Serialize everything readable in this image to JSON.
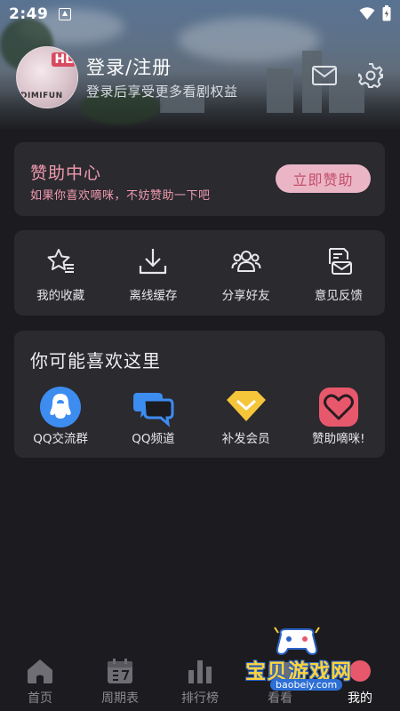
{
  "status": {
    "time": "2:49"
  },
  "header": {
    "avatar_tag": "HL",
    "avatar_sub": "DIMIFUN",
    "login_title": "登录/注册",
    "login_subtitle": "登录后享受更多看剧权益",
    "icons": [
      "mail-icon",
      "settings-icon"
    ]
  },
  "sponsor": {
    "title": "赞助中心",
    "subtitle": "如果你喜欢嘀咪，不妨赞助一下吧",
    "button": "立即赞助",
    "accent": "#f19aae"
  },
  "quick_actions": [
    {
      "label": "我的收藏",
      "icon": "favorites-star-icon"
    },
    {
      "label": "离线缓存",
      "icon": "download-icon"
    },
    {
      "label": "分享好友",
      "icon": "share-friends-icon"
    },
    {
      "label": "意见反馈",
      "icon": "feedback-icon"
    }
  ],
  "recommend": {
    "title": "你可能喜欢这里",
    "items": [
      {
        "label": "QQ交流群",
        "icon": "qq-icon",
        "color": "#3d8cf0"
      },
      {
        "label": "QQ频道",
        "icon": "qq-channel-icon",
        "color": "#3d8cf0"
      },
      {
        "label": "补发会员",
        "icon": "diamond-icon",
        "color": "#f5c53a"
      },
      {
        "label": "赞助嘀咪!",
        "icon": "heart-icon",
        "color": "#e8586c"
      }
    ]
  },
  "bottom_nav": [
    {
      "label": "首页",
      "icon": "home-icon",
      "active": false
    },
    {
      "label": "周期表",
      "icon": "calendar-icon",
      "active": false
    },
    {
      "label": "排行榜",
      "icon": "ranking-icon",
      "active": false
    },
    {
      "label": "看看",
      "icon": "watch-icon",
      "active": false
    },
    {
      "label": "我的",
      "icon": "profile-icon",
      "active": true
    }
  ],
  "watermark": {
    "text": "宝贝游戏网",
    "url": "baobeiy.com"
  }
}
